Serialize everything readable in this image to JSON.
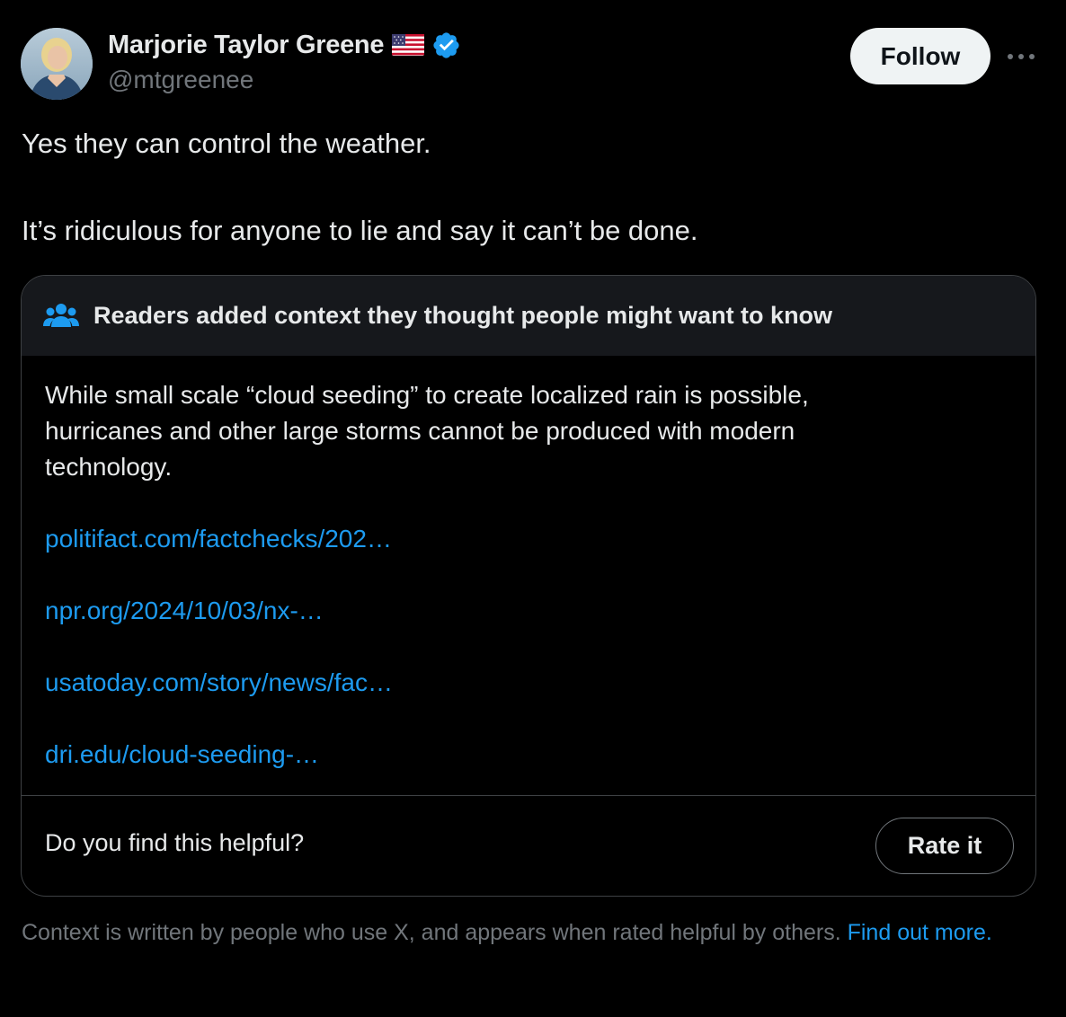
{
  "author": {
    "display_name": "Marjorie Taylor Greene",
    "handle": "@mtgreenee",
    "flag": "flag-usa-icon",
    "verified": true,
    "verified_color": "#1d9bf0"
  },
  "actions": {
    "follow_label": "Follow",
    "more_icon": "more-horizontal-icon"
  },
  "tweet": {
    "paragraphs": [
      "Yes they can control the weather.",
      "It’s ridiculous for anyone to lie and say it can’t be done."
    ]
  },
  "community_note": {
    "header_icon": "people-icon",
    "header_title": "Readers added context they thought people might want to know",
    "text": "While small scale “cloud seeding” to create localized rain is possible, hurricanes and other large storms cannot be produced with modern technology.",
    "links": [
      "politifact.com/factchecks/202…",
      "npr.org/2024/10/03/nx-…",
      "usatoday.com/story/news/fac…",
      "dri.edu/cloud-seeding-…"
    ],
    "helpful_question": "Do you find this helpful?",
    "rate_label": "Rate it"
  },
  "disclaimer": {
    "text": "Context is written by people who use X, and appears when rated helpful by others. ",
    "link_label": "Find out more."
  },
  "colors": {
    "background": "#000000",
    "text_primary": "#e7e9ea",
    "text_secondary": "#71767b",
    "link": "#1d9bf0",
    "card_header": "#16181c",
    "border": "#3e4144",
    "follow_bg": "#eff3f4"
  }
}
